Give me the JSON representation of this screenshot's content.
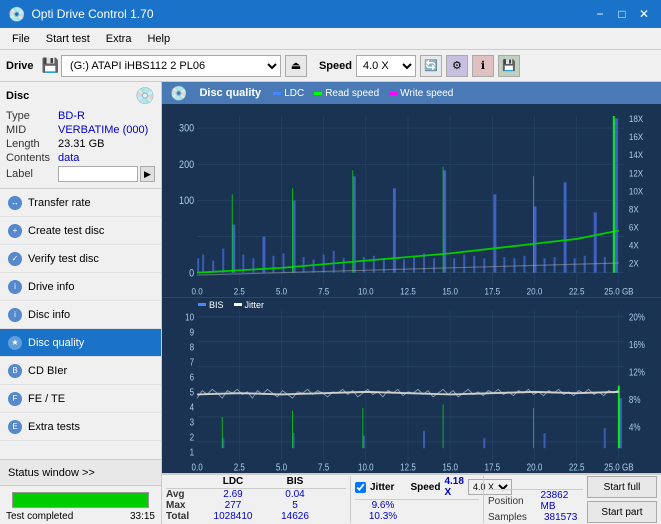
{
  "titlebar": {
    "title": "Opti Drive Control 1.70",
    "minimize": "−",
    "maximize": "□",
    "close": "✕"
  },
  "menubar": {
    "items": [
      "File",
      "Start test",
      "Extra",
      "Help"
    ]
  },
  "toolbar": {
    "drive_label": "Drive",
    "drive_value": "(G:) ATAPI iHBS112  2 PL06",
    "speed_label": "Speed",
    "speed_value": "4.0 X"
  },
  "disc": {
    "title": "Disc",
    "type_label": "Type",
    "type_value": "BD-R",
    "mid_label": "MID",
    "mid_value": "VERBATIMe (000)",
    "length_label": "Length",
    "length_value": "23.31 GB",
    "contents_label": "Contents",
    "contents_value": "data",
    "label_label": "Label",
    "label_value": ""
  },
  "nav": {
    "items": [
      {
        "id": "transfer-rate",
        "label": "Transfer rate",
        "active": false
      },
      {
        "id": "create-test-disc",
        "label": "Create test disc",
        "active": false
      },
      {
        "id": "verify-test-disc",
        "label": "Verify test disc",
        "active": false
      },
      {
        "id": "drive-info",
        "label": "Drive info",
        "active": false
      },
      {
        "id": "disc-info",
        "label": "Disc info",
        "active": false
      },
      {
        "id": "disc-quality",
        "label": "Disc quality",
        "active": true
      },
      {
        "id": "cd-bier",
        "label": "CD BIer",
        "active": false
      },
      {
        "id": "fe-te",
        "label": "FE / TE",
        "active": false
      },
      {
        "id": "extra-tests",
        "label": "Extra tests",
        "active": false
      }
    ]
  },
  "chart": {
    "title": "Disc quality",
    "legend": [
      {
        "label": "LDC",
        "color": "#4488ff"
      },
      {
        "label": "Read speed",
        "color": "#00ff00"
      },
      {
        "label": "Write speed",
        "color": "#ff00ff"
      }
    ],
    "legend2": [
      {
        "label": "BIS",
        "color": "#4488ff"
      },
      {
        "label": "Jitter",
        "color": "#ffffff"
      }
    ],
    "y_axis_top": [
      "300",
      "200",
      "100",
      "0"
    ],
    "y_axis_right_top": [
      "18X",
      "16X",
      "14X",
      "12X",
      "10X",
      "8X",
      "6X",
      "4X",
      "2X"
    ],
    "x_axis": [
      "0.0",
      "2.5",
      "5.0",
      "7.5",
      "10.0",
      "12.5",
      "15.0",
      "17.5",
      "20.0",
      "22.5",
      "25.0 GB"
    ],
    "y_axis_bottom": [
      "10",
      "9",
      "8",
      "7",
      "6",
      "5",
      "4",
      "3",
      "2",
      "1"
    ],
    "y_axis_right_bottom": [
      "20%",
      "16%",
      "12%",
      "8%",
      "4%"
    ]
  },
  "stats": {
    "col_headers": [
      "LDC",
      "BIS",
      "",
      "Jitter",
      "Speed",
      "4.18 X",
      "4.0 X"
    ],
    "rows": [
      {
        "label": "Avg",
        "ldc": "2.69",
        "bis": "0.04",
        "jitter": "9.6%"
      },
      {
        "label": "Max",
        "ldc": "277",
        "bis": "5",
        "jitter": "10.3%"
      },
      {
        "label": "Total",
        "ldc": "1028410",
        "bis": "14626",
        "jitter": ""
      }
    ],
    "position_label": "Position",
    "position_value": "23862 MB",
    "samples_label": "Samples",
    "samples_value": "381573",
    "jitter_checked": true,
    "jitter_label": "Jitter",
    "speed_label": "Speed",
    "speed_display": "4.18 X",
    "speed_select": "4.0 X",
    "start_full_label": "Start full",
    "start_part_label": "Start part"
  },
  "statusbar": {
    "status_window_label": "Status window >>",
    "progress_percent": 100,
    "progress_text": "Test completed",
    "time": "33:15"
  }
}
